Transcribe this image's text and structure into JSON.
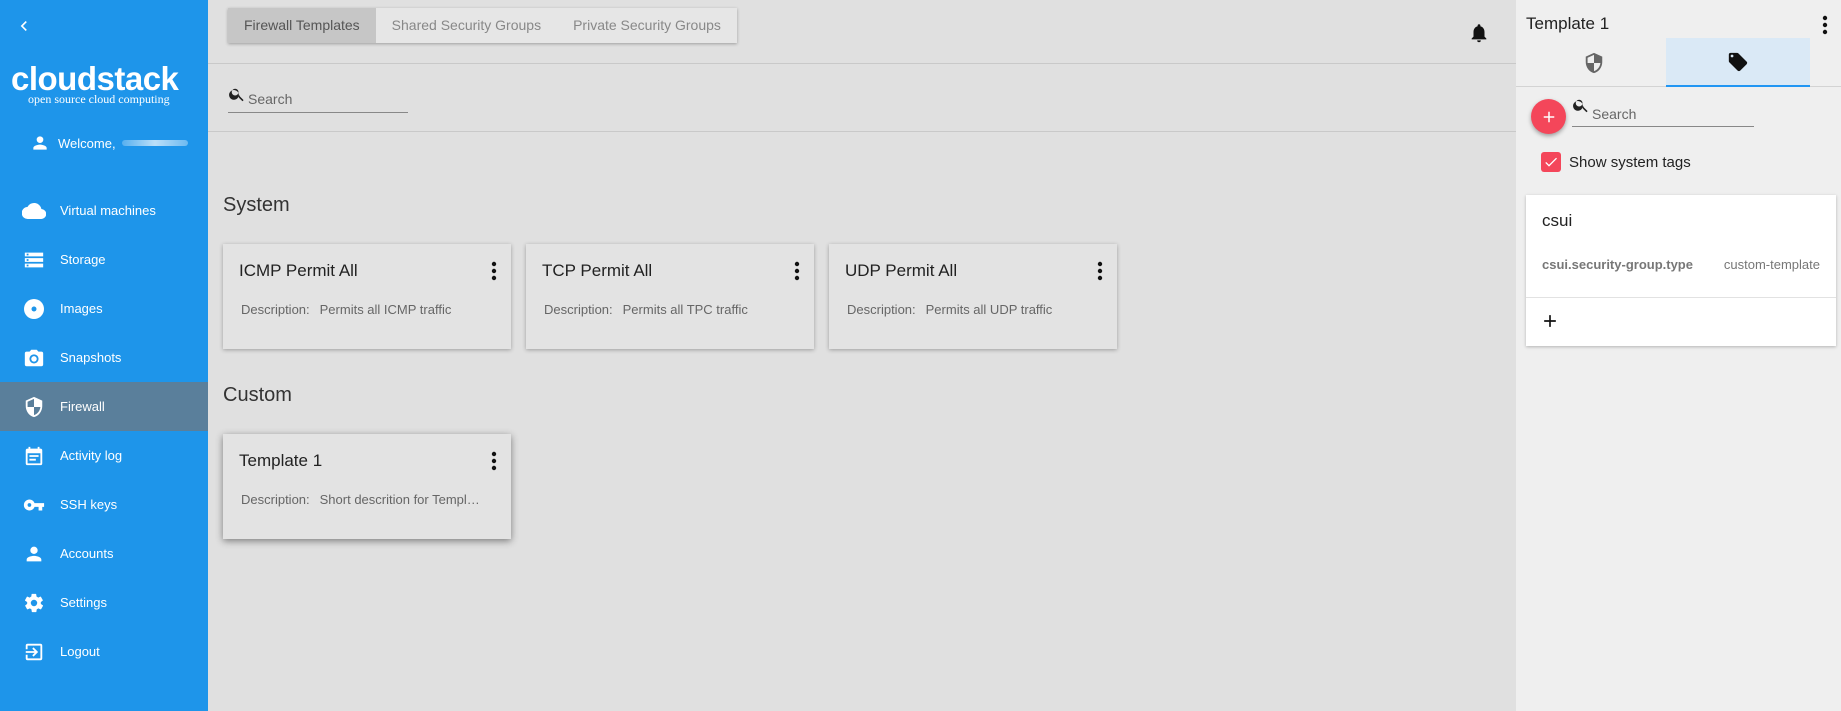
{
  "sidebar": {
    "logo_main": "cloudstack",
    "logo_sub": "open source cloud computing",
    "welcome": "Welcome,",
    "items": [
      {
        "label": "Virtual machines",
        "icon": "cloud-icon"
      },
      {
        "label": "Storage",
        "icon": "storage-icon"
      },
      {
        "label": "Images",
        "icon": "disc-icon"
      },
      {
        "label": "Snapshots",
        "icon": "camera-icon"
      },
      {
        "label": "Firewall",
        "icon": "shield-icon",
        "active": true
      },
      {
        "label": "Activity log",
        "icon": "calendar-icon"
      },
      {
        "label": "SSH keys",
        "icon": "key-icon"
      },
      {
        "label": "Accounts",
        "icon": "person-icon"
      },
      {
        "label": "Settings",
        "icon": "gear-icon"
      },
      {
        "label": "Logout",
        "icon": "logout-icon"
      }
    ]
  },
  "main": {
    "tabs": [
      {
        "label": "Firewall Templates",
        "active": true
      },
      {
        "label": "Shared Security Groups"
      },
      {
        "label": "Private Security Groups"
      }
    ],
    "search_placeholder": "Search",
    "sections": [
      {
        "title": "System",
        "cards": [
          {
            "title": "ICMP Permit All",
            "desc_label": "Description:",
            "desc": "Permits all ICMP traffic"
          },
          {
            "title": "TCP Permit All",
            "desc_label": "Description:",
            "desc": "Permits all TPC traffic"
          },
          {
            "title": "UDP Permit All",
            "desc_label": "Description:",
            "desc": "Permits all UDP traffic"
          }
        ]
      },
      {
        "title": "Custom",
        "cards": [
          {
            "title": "Template 1",
            "desc_label": "Description:",
            "desc": "Short descrition for Templ…"
          }
        ]
      }
    ]
  },
  "panel": {
    "title": "Template 1",
    "search_placeholder": "Search",
    "show_system_tags": "Show system tags",
    "show_system_tags_checked": true,
    "tag_group": "csui",
    "tag_key": "csui.security-group.type",
    "tag_value": "custom-template"
  },
  "colors": {
    "sidebar": "#1e95ea",
    "accent_red": "#f4465a",
    "active_tab_blue": "#2196f3"
  }
}
